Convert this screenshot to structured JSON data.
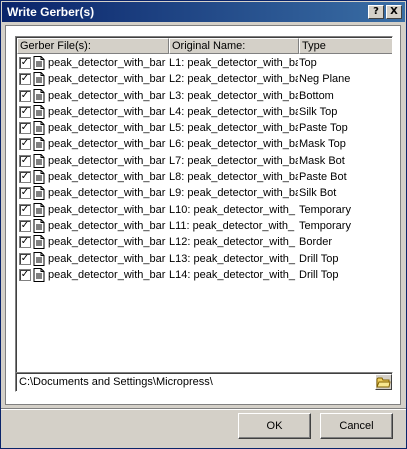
{
  "window": {
    "title": "Write Gerber(s)",
    "help_label": "?",
    "close_label": "X"
  },
  "columns": {
    "file": "Gerber File(s):",
    "original": "Original Name:",
    "type": "Type"
  },
  "rows": [
    {
      "file": "peak_detector_with_bar",
      "original": "L1: peak_detector_with_ba",
      "type": "Top",
      "checked": "✓"
    },
    {
      "file": "peak_detector_with_bar",
      "original": "L2: peak_detector_with_ba",
      "type": "Neg Plane",
      "checked": "✓"
    },
    {
      "file": "peak_detector_with_bar",
      "original": "L3: peak_detector_with_ba",
      "type": "Bottom",
      "checked": "✓"
    },
    {
      "file": "peak_detector_with_bar",
      "original": "L4: peak_detector_with_ba",
      "type": "Silk Top",
      "checked": "✓"
    },
    {
      "file": "peak_detector_with_bar",
      "original": "L5: peak_detector_with_ba",
      "type": "Paste Top",
      "checked": "✓"
    },
    {
      "file": "peak_detector_with_bar",
      "original": "L6: peak_detector_with_ba",
      "type": "Mask Top",
      "checked": "✓"
    },
    {
      "file": "peak_detector_with_bar",
      "original": "L7: peak_detector_with_ba",
      "type": "Mask Bot",
      "checked": "✓"
    },
    {
      "file": "peak_detector_with_bar",
      "original": "L8: peak_detector_with_ba",
      "type": "Paste Bot",
      "checked": "✓"
    },
    {
      "file": "peak_detector_with_bar",
      "original": "L9: peak_detector_with_ba",
      "type": "Silk Bot",
      "checked": "✓"
    },
    {
      "file": "peak_detector_with_bar",
      "original": "L10: peak_detector_with_",
      "type": "Temporary",
      "checked": "✓"
    },
    {
      "file": "peak_detector_with_bar",
      "original": "L11: peak_detector_with_",
      "type": "Temporary",
      "checked": "✓"
    },
    {
      "file": "peak_detector_with_bar",
      "original": "L12: peak_detector_with_",
      "type": "Border",
      "checked": "✓"
    },
    {
      "file": "peak_detector_with_bar",
      "original": "L13: peak_detector_with_",
      "type": "Drill Top",
      "checked": "✓"
    },
    {
      "file": "peak_detector_with_bar",
      "original": "L14: peak_detector_with_",
      "type": "Drill Top",
      "checked": "✓"
    }
  ],
  "path": {
    "value": "C:\\Documents and Settings\\Micropress\\"
  },
  "buttons": {
    "ok": "OK",
    "cancel": "Cancel"
  },
  "icons": {
    "row_icon": "document-icon",
    "browse_icon": "folder-icon"
  },
  "colors": {
    "title_start": "#0a246a",
    "title_end": "#3a6ea5",
    "face": "#d4d0c8"
  }
}
